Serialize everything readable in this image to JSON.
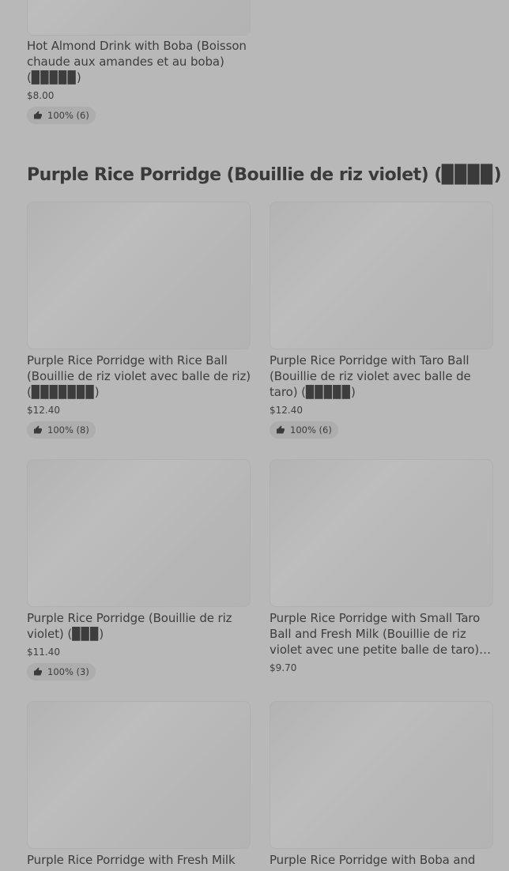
{
  "top_item": {
    "title": "Hot Almond Drink with Boba (Boisson chaude aux amandes et au boba) (▉▉▉▉▉)",
    "price": "$8.00",
    "rating": "100% (6)"
  },
  "section": {
    "title": "Purple Rice Porridge (Bouillie de riz violet) (▉▉▉▉)"
  },
  "items": [
    {
      "title": "Purple Rice Porridge with Rice Ball (Bouillie de riz violet avec balle de riz) (▉▉▉▉▉▉▉)",
      "price": "$12.40",
      "rating": "100% (8)"
    },
    {
      "title": "Purple Rice Porridge with Taro Ball (Bouillie de riz violet avec balle de taro) (▉▉▉▉▉)",
      "price": "$12.40",
      "rating": "100% (6)"
    },
    {
      "title": "Purple Rice Porridge (Bouillie de riz violet) (▉▉▉)",
      "price": "$11.40",
      "rating": "100% (3)"
    },
    {
      "title": "Purple Rice Porridge with Small Taro Ball and Fresh Milk (Bouillie de riz violet avec une petite balle de taro) et lait frais",
      "price": "$9.70"
    },
    {
      "title": "Purple Rice Porridge with Fresh Milk"
    },
    {
      "title": "Purple Rice Porridge with Boba and"
    }
  ],
  "colors": {
    "background": "#b8b8b8",
    "text": "#3a3a3a",
    "badge": "#adadad"
  },
  "icons": {
    "rating": "thumbs-up-icon"
  }
}
